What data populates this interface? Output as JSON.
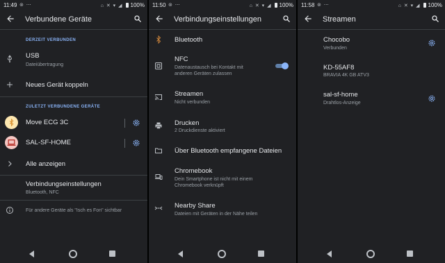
{
  "status_bars": [
    {
      "time": "11:49",
      "battery": "100%"
    },
    {
      "time": "11:50",
      "battery": "100%"
    },
    {
      "time": "11:58",
      "battery": "100%"
    }
  ],
  "screen1": {
    "title": "Verbundene Geräte",
    "section_current": "DERZEIT VERBUNDEN",
    "usb": {
      "title": "USB",
      "subtitle": "Dateiübertragung"
    },
    "pair_new": "Neues Gerät koppeln",
    "section_recent": "ZULETZT VERBUNDENE GERÄTE",
    "device1": "Move ECG 3C",
    "device2": "SAL-SF-HOME",
    "show_all": "Alle anzeigen",
    "connection_prefs": {
      "title": "Verbindungseinstellungen",
      "subtitle": "Bluetooth, NFC"
    },
    "footnote": "Für andere Geräte als \"Isch es Fon\" sichtbar"
  },
  "screen2": {
    "title": "Verbindungseinstellungen",
    "bluetooth": "Bluetooth",
    "nfc": {
      "title": "NFC",
      "subtitle_line1": "Datenaustausch bei Kontakt mit",
      "subtitle_line2": "anderen Geräten zulassen",
      "enabled": true
    },
    "cast": {
      "title": "Streamen",
      "subtitle": "Nicht verbunden"
    },
    "printing": {
      "title": "Drucken",
      "subtitle": "2 Druckdienste aktiviert"
    },
    "received_files": "Über Bluetooth empfangene Dateien",
    "chromebook": {
      "title": "Chromebook",
      "subtitle_line1": "Dein Smartphone ist nicht mit einem",
      "subtitle_line2": "Chromebook verknüpft"
    },
    "nearby": {
      "title": "Nearby Share",
      "subtitle": "Dateien mit Geräten in der Nähe teilen"
    }
  },
  "screen3": {
    "title": "Streamen",
    "items": [
      {
        "title": "Chocobo",
        "subtitle": "Verbunden"
      },
      {
        "title": "KD-55AF8",
        "subtitle": "BRAVIA 4K GB ATV3"
      },
      {
        "title": "sal-sf-home",
        "subtitle": "Drahtlos-Anzeige"
      }
    ]
  },
  "colors": {
    "background": "#202124",
    "accent": "#8ab4f8",
    "bluetooth_disabled": "#c5803a"
  }
}
